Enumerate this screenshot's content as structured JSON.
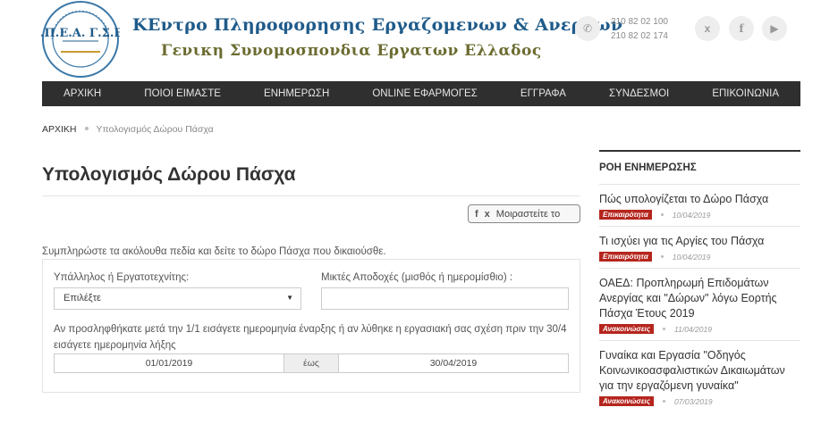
{
  "header": {
    "logo_text": "ΚΕ.Π.Ε.Α. Γ.Σ.Ε.Ε.",
    "org_line1": "ΚΕντρο Πληροφορησης Εργαζομενων & Ανεργων",
    "org_line2": "Γενικη Συνομοσπονδια Εργατων Ελλαδος",
    "phones": [
      "210 82 02 100",
      "210 82 02 174"
    ],
    "icons": [
      "phone-icon",
      "twitter-icon",
      "facebook-icon",
      "youtube-icon"
    ]
  },
  "nav": {
    "items": [
      "ΑΡΧΙΚΗ",
      "ΠΟΙΟΙ ΕΙΜΑΣΤΕ",
      "ΕΝΗΜΕΡΩΣΗ",
      "ONLINE ΕΦΑΡΜΟΓΕΣ",
      "ΕΓΓΡΑΦΑ",
      "ΣΥΝΔΕΣΜΟΙ",
      "ΕΠΙΚΟΙΝΩΝΙΑ"
    ]
  },
  "breadcrumb": {
    "home": "ΑΡΧΙΚΗ",
    "current": "Υπολογισμός Δώρου Πάσχα"
  },
  "page": {
    "title": "Υπολογισμός Δώρου Πάσχα",
    "share_label": "Μοιραστείτε το",
    "intro": "Συμπληρώστε τα ακόλουθα πεδία και δείτε το δώρο Πάσχα που δικαιούσθε."
  },
  "form": {
    "type_label": "Υπάλληλος ή Εργατοτεχνίτης:",
    "type_value": "Επιλέξτε",
    "wage_label": "Μικτές Αποδοχές (μισθός ή ημερομίσθιο) :",
    "wage_value": "",
    "dates_note": "Αν προσληφθήκατε μετά την 1/1 εισάγετε ημερομηνία έναρξης ή αν λύθηκε η εργασιακή σας σχέση πριν την 30/4 εισάγετε ημερομηνία λήξης",
    "date_from": "01/01/2019",
    "date_sep": "έως",
    "date_to": "30/04/2019"
  },
  "sidebar": {
    "title": "ΡΟΗ ΕΝΗΜΕΡΩΣΗΣ",
    "items": [
      {
        "title": "Πώς υπολογίζεται το Δώρο Πάσχα",
        "category": "Επικαιρότητα",
        "date": "10/04/2019"
      },
      {
        "title": "Τι ισχύει για τις Αργίες του Πάσχα",
        "category": "Επικαιρότητα",
        "date": "10/04/2019"
      },
      {
        "title": "ΟΑΕΔ: Προπληρωμή Επιδομάτων Ανεργίας και \"Δώρων\" λόγω Εορτής Πάσχα Έτους 2019",
        "category": "Ανακοινώσεις",
        "date": "11/04/2019"
      },
      {
        "title": "Γυναίκα και Εργασία \"Οδηγός Κοινωνικοασφαλιστικών Δικαιωμάτων για την εργαζόμενη γυναίκα\"",
        "category": "Ανακοινώσεις",
        "date": "07/03/2019"
      }
    ]
  },
  "colors": {
    "nav_bg": "#2f2f2f",
    "badge": "#b5261e",
    "org_blue": "#1f5b8a",
    "org_olive": "#6b6b30"
  }
}
